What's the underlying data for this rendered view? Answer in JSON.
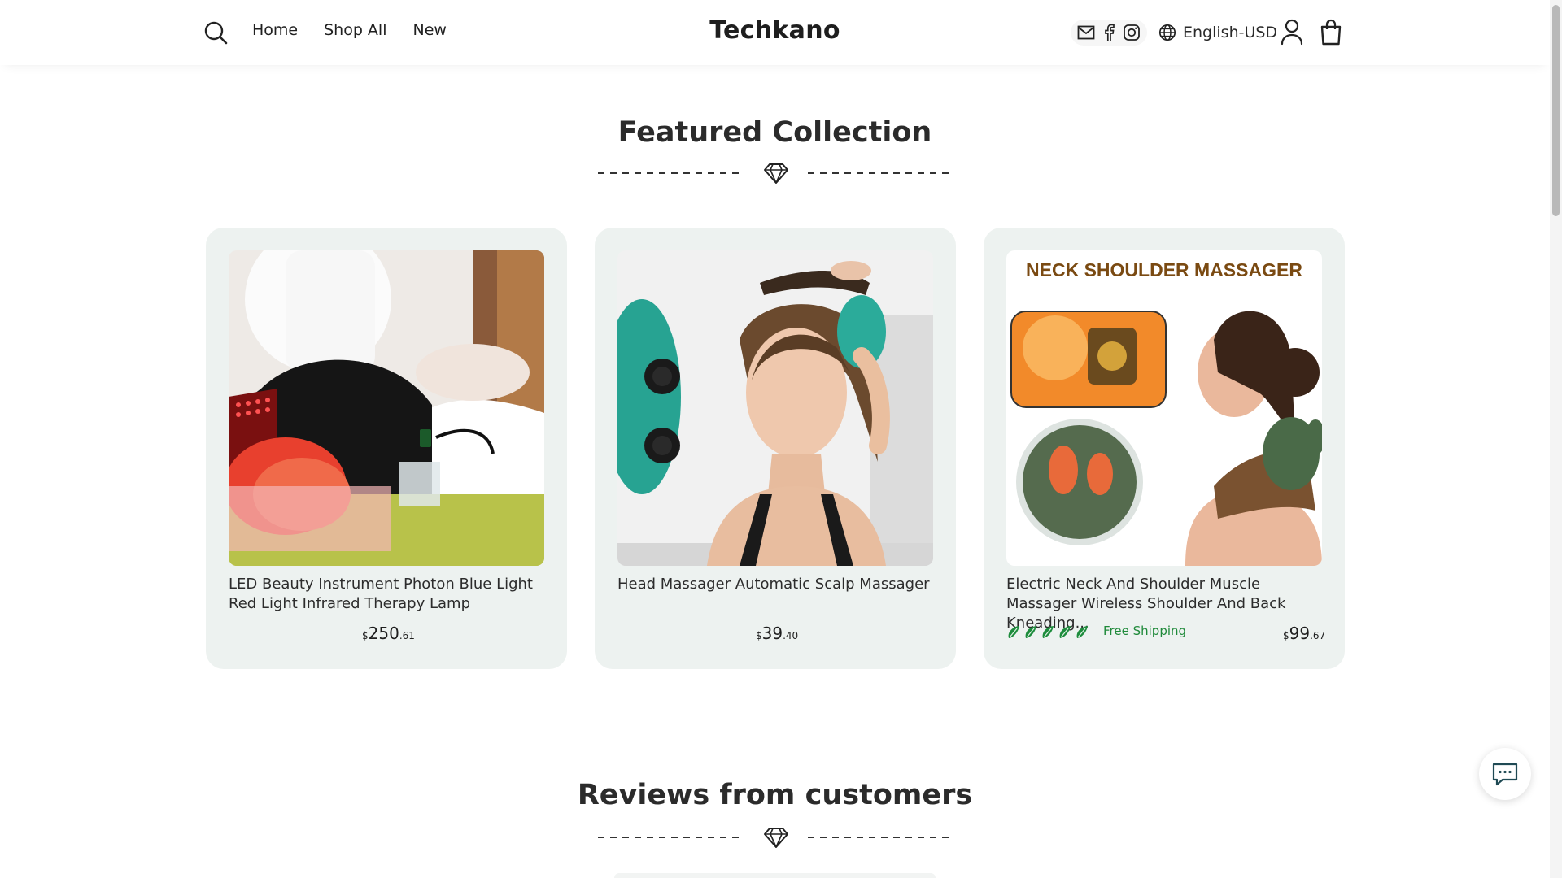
{
  "header": {
    "brand": "Techkano",
    "nav": [
      "Home",
      "Shop All",
      "New"
    ],
    "language": "English-USD",
    "icons": [
      "search-icon",
      "mail-icon",
      "facebook-icon",
      "instagram-icon",
      "globe-icon",
      "user-icon",
      "bag-icon"
    ]
  },
  "featured": {
    "title": "Featured Collection",
    "products": [
      {
        "title": "LED Beauty Instrument Photon Blue Light Red Light Infrared Therapy Lamp",
        "currency": "$",
        "price_main": "250",
        "price_cents": ".61"
      },
      {
        "title": "Head Massager Automatic Scalp Massager",
        "currency": "$",
        "price_main": "39",
        "price_cents": ".40"
      },
      {
        "title": "Electric Neck And Shoulder Muscle Massager Wireless Shoulder And Back Kneading...",
        "currency": "$",
        "price_main": "99",
        "price_cents": ".67",
        "rating": 5,
        "shipping": "Free Shipping",
        "image_text": "NECK SHOULDER MASSAGER"
      }
    ]
  },
  "reviews": {
    "title": "Reviews from customers"
  },
  "colors": {
    "card_bg": "#edf2f0",
    "star_green": "#1d8c3c",
    "accent_text": "#1f8a3a"
  }
}
